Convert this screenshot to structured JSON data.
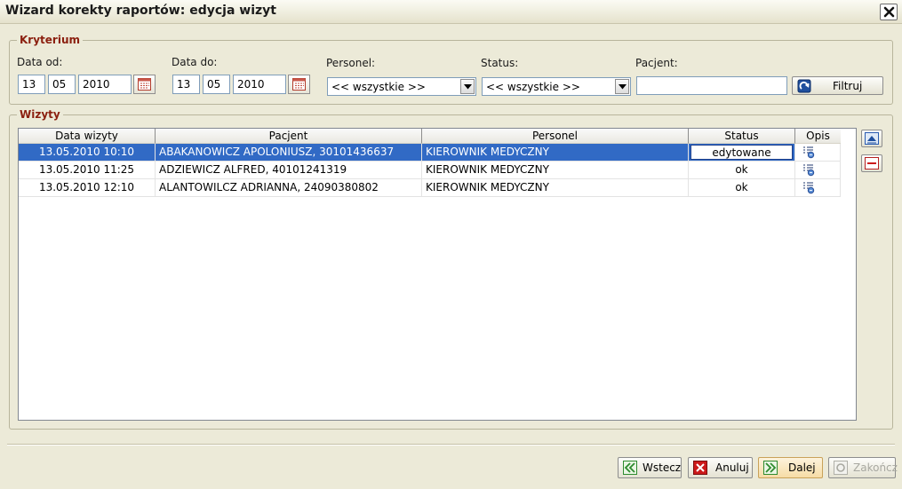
{
  "window": {
    "title": "Wizard korekty raportów: edycja wizyt"
  },
  "kryterium": {
    "legend": "Kryterium",
    "data_od": {
      "label": "Data od:",
      "day": "13",
      "month": "05",
      "year": "2010"
    },
    "data_do": {
      "label": "Data do:",
      "day": "13",
      "month": "05",
      "year": "2010"
    },
    "personel": {
      "label": "Personel:",
      "value": "<< wszystkie >>"
    },
    "status": {
      "label": "Status:",
      "value": "<< wszystkie >>"
    },
    "pacjent": {
      "label": "Pacjent:",
      "value": ""
    },
    "filter_button": "Filtruj"
  },
  "wizyty": {
    "legend": "Wizyty",
    "columns": [
      "Data wizyty",
      "Pacjent",
      "Personel",
      "Status",
      "Opis"
    ],
    "rows": [
      {
        "date": "13.05.2010 10:10",
        "patient": "ABAKANOWICZ APOLONIUSZ, 30101436637",
        "staff": "KIEROWNIK MEDYCZNY",
        "status": "edytowane",
        "selected": true
      },
      {
        "date": "13.05.2010 11:25",
        "patient": "ADZIEWICZ ALFRED, 40101241319",
        "staff": "KIEROWNIK MEDYCZNY",
        "status": "ok",
        "selected": false
      },
      {
        "date": "13.05.2010 12:10",
        "patient": "ALANTOWILCZ ADRIANNA, 24090380802",
        "staff": "KIEROWNIK MEDYCZNY",
        "status": "ok",
        "selected": false
      }
    ]
  },
  "footer": {
    "back": "Wstecz",
    "cancel": "Anuluj",
    "next": "Dalej",
    "finish": "Zakończ"
  },
  "colors": {
    "selection": "#316ac5",
    "legend": "#8b1f0f",
    "window_bg": "#ecead8",
    "cancel_icon": "#cc1a1a",
    "nav_icon": "#2e8b2e",
    "next_highlight": "#fbe6b8"
  },
  "icons": {
    "close": "close-icon",
    "calendar": "calendar-icon",
    "filter": "filter-icon",
    "description": "note-icon",
    "move_up": "move-up-icon",
    "remove": "remove-icon",
    "back": "back-arrow-icon",
    "cancel": "cancel-icon",
    "next": "next-arrow-icon",
    "finish": "finish-icon"
  }
}
